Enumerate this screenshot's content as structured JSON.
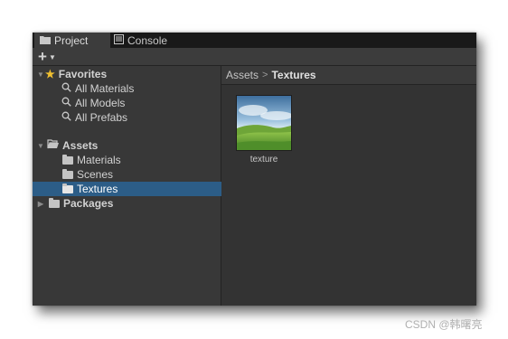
{
  "tabs": [
    {
      "label": "Project",
      "icon": "folder-icon",
      "active": true
    },
    {
      "label": "Console",
      "icon": "console-icon",
      "active": false
    }
  ],
  "toolbar": {
    "create_label": "+"
  },
  "tree": {
    "favorites": {
      "label": "Favorites",
      "items": [
        {
          "label": "All Materials",
          "icon": "search-icon"
        },
        {
          "label": "All Models",
          "icon": "search-icon"
        },
        {
          "label": "All Prefabs",
          "icon": "search-icon"
        }
      ]
    },
    "assets": {
      "label": "Assets",
      "items": [
        {
          "label": "Materials",
          "icon": "folder-icon",
          "selected": false
        },
        {
          "label": "Scenes",
          "icon": "folder-icon",
          "selected": false
        },
        {
          "label": "Textures",
          "icon": "folder-icon",
          "selected": true
        }
      ]
    },
    "packages": {
      "label": "Packages"
    }
  },
  "breadcrumb": {
    "root": "Assets",
    "separator": ">",
    "current": "Textures"
  },
  "assets_grid": [
    {
      "name": "texture",
      "thumbnail": "landscape-thumbnail"
    }
  ],
  "watermark": "CSDN @韩曙亮",
  "colors": {
    "window_bg": "#383838",
    "tabbar_bg": "#191919",
    "selection": "#2c5d87",
    "star": "#f0c030"
  }
}
